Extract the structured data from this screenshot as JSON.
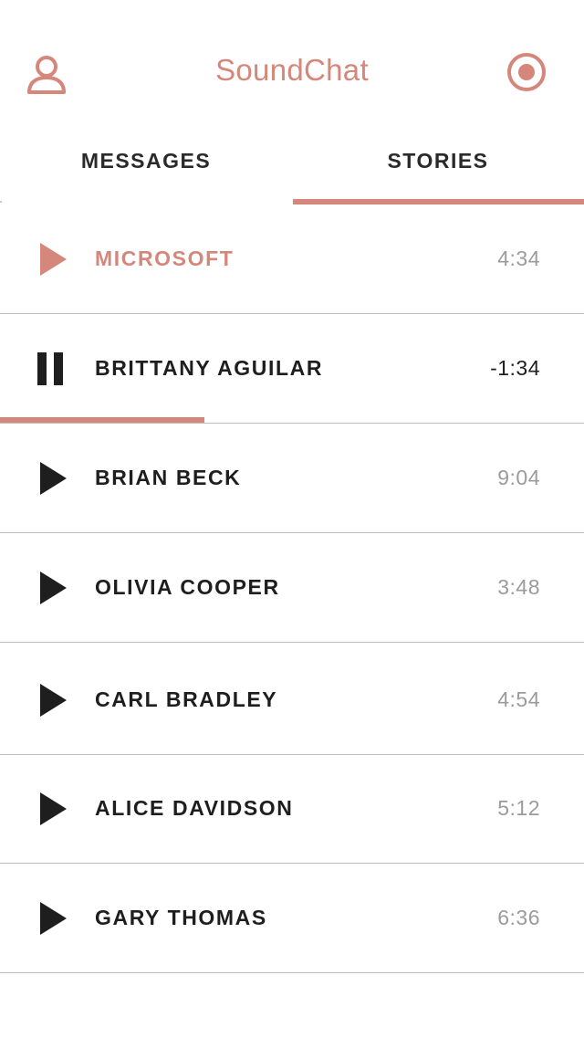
{
  "app": {
    "title": "SoundChat"
  },
  "header": {
    "profile_icon": "user-icon",
    "record_icon": "record-icon"
  },
  "tabs": [
    {
      "label": "MESSAGES",
      "selected": false
    },
    {
      "label": "STORIES",
      "selected": true
    }
  ],
  "colors": {
    "accent": "#d5877b",
    "text": "#1e1e1e",
    "muted": "#9b9b9b",
    "divider": "#bdbdbd"
  },
  "stories": [
    {
      "name": "MICROSOFT",
      "duration": "4:34",
      "state": "selected",
      "icon": "play-icon"
    },
    {
      "name": "BRITTANY AGUILAR",
      "duration": "-1:34",
      "state": "playing",
      "icon": "pause-icon",
      "progress_fraction": 0.35
    },
    {
      "name": "BRIAN BECK",
      "duration": "9:04",
      "state": "idle",
      "icon": "play-icon"
    },
    {
      "name": "OLIVIA COOPER",
      "duration": "3:48",
      "state": "idle",
      "icon": "play-icon"
    },
    {
      "name": "CARL BRADLEY",
      "duration": "4:54",
      "state": "idle",
      "icon": "play-icon"
    },
    {
      "name": "ALICE DAVIDSON",
      "duration": "5:12",
      "state": "idle",
      "icon": "play-icon"
    },
    {
      "name": "GARY THOMAS",
      "duration": "6:36",
      "state": "idle",
      "icon": "play-icon"
    }
  ]
}
